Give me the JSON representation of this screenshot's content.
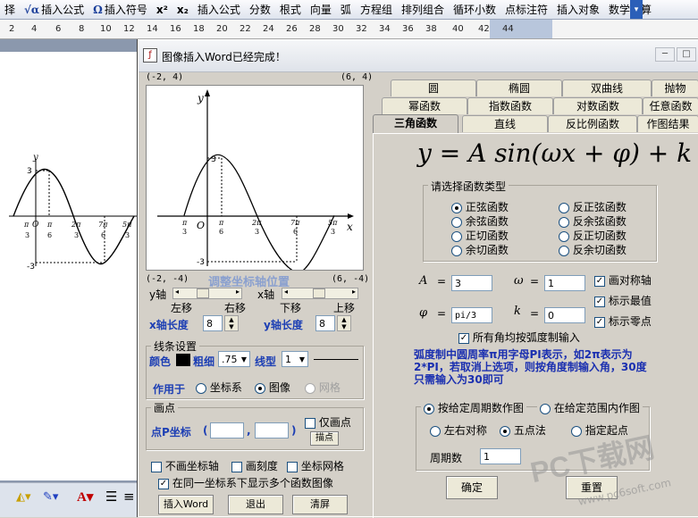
{
  "toolbar": {
    "items": [
      "择",
      "插入公式",
      "插入符号",
      "x²",
      "x₂",
      "插入公式",
      "分数",
      "根式",
      "向量",
      "弧",
      "方程组",
      "排列组合",
      "循环小数",
      "点标注符",
      "插入对象",
      "数学计算"
    ],
    "icons": [
      "",
      "√α",
      "Ω",
      "",
      "",
      "",
      "",
      "",
      "",
      "",
      "",
      "",
      "",
      "",
      "",
      ""
    ]
  },
  "ruler": {
    "ticks": [
      "2",
      "4",
      "6",
      "8",
      "10",
      "12",
      "14",
      "16",
      "18",
      "20",
      "22",
      "24",
      "26",
      "28",
      "30",
      "32",
      "34",
      "36",
      "38",
      "40",
      "42",
      "44"
    ]
  },
  "doc_graph": {
    "y_top": "3",
    "y_bottom": "-3",
    "y_axis": "y",
    "x_ticks": [
      "-π/3",
      "O",
      "π/6",
      "2π/3",
      "7π/6",
      "5π/3"
    ],
    "x_labels": {
      "neg_pi3_num": "π",
      "neg_pi3_den": "3",
      "o": "O",
      "pi6_num": "π",
      "pi6_den": "6",
      "a_num": "2π",
      "a_den": "3",
      "b_num": "7π",
      "b_den": "6",
      "c_num": "5π",
      "c_den": "3"
    }
  },
  "dialog": {
    "title": "图像插入Word已经完成！",
    "graph": {
      "corner_tl": "(-2, 4)",
      "corner_tr": "(6, 4)",
      "corner_bl": "(-2, -4)",
      "corner_br": "(6, -4)",
      "y_label": "y",
      "x_label": "x",
      "origin": "O",
      "y_max": "3",
      "y_min": "-3",
      "ticks": {
        "t1_num": "π",
        "t1_den": "3",
        "t2_num": "π",
        "t2_den": "6",
        "t3_num": "2π",
        "t3_den": "3",
        "t4_num": "7π",
        "t4_den": "6",
        "t5_num": "5π",
        "t5_den": "3"
      }
    },
    "axis_adjust": {
      "title": "调整坐标轴位置",
      "y_axis": "y轴",
      "x_axis": "x轴",
      "left": "左移",
      "right": "右移",
      "down": "下移",
      "up": "上移",
      "x_len_label": "x轴长度",
      "x_len": "8",
      "y_len_label": "y轴长度",
      "y_len": "8"
    },
    "line": {
      "title": "线条设置",
      "color": "颜色",
      "width_label": "粗细",
      "width": ".75",
      "type_label": "线型",
      "type": "1",
      "apply_label": "作用于",
      "opt_axes": "坐标系",
      "opt_image": "图像",
      "opt_grid": "网格"
    },
    "point": {
      "title": "画点",
      "coord_label": "点P坐标",
      "lparen": "(",
      "comma": ",",
      "rparen": ")",
      "only": "仅画点",
      "btn": "描点"
    },
    "checks": {
      "no_axes": "不画坐标轴",
      "ticks": "画刻度",
      "grid": "坐标网格",
      "multi": "在同一坐标系下显示多个函数图像"
    },
    "buttons": {
      "insert": "插入Word",
      "exit": "退出",
      "clear": "清屏"
    },
    "tabs_row1": [
      "圆",
      "椭圆",
      "双曲线",
      "抛物"
    ],
    "tabs_row2": [
      "幂函数",
      "指数函数",
      "对数函数",
      "任意函数"
    ],
    "tabs_row3": [
      "三角函数",
      "直线",
      "反比例函数",
      "作图结果"
    ],
    "formula": "y = A sin(ωx + φ) + k",
    "func_type": {
      "title": "请选择函数类型",
      "left": [
        "正弦函数",
        "余弦函数",
        "正切函数",
        "余切函数"
      ],
      "right": [
        "反正弦函数",
        "反余弦函数",
        "反正切函数",
        "反余切函数"
      ]
    },
    "params": {
      "A_label": "A",
      "A": "3",
      "w_label": "ω",
      "w": "1",
      "phi_label": "φ",
      "phi": "pi/3",
      "k_label": "k",
      "k": "0",
      "eq": "=",
      "sym_axis": "画对称轴",
      "max": "标示最值",
      "zero": "标示零点",
      "all_rad": "所有角均按弧度制输入"
    },
    "note": "弧度制中圆周率π用字母PI表示，如2π表示为2*PI，若取消上选项，则按角度制输入角，30度只需输入为30即可",
    "period": {
      "mode1": "按给定周期数作图",
      "mode2": "在给定范围内作图",
      "opt1": "左右对称",
      "opt2": "五点法",
      "opt3": "指定起点",
      "count_label": "周期数",
      "count": "1"
    },
    "ok": "确定",
    "reset": "重置"
  },
  "watermark": {
    "big": "PC下载网",
    "small": "www.pc6soft.com"
  }
}
